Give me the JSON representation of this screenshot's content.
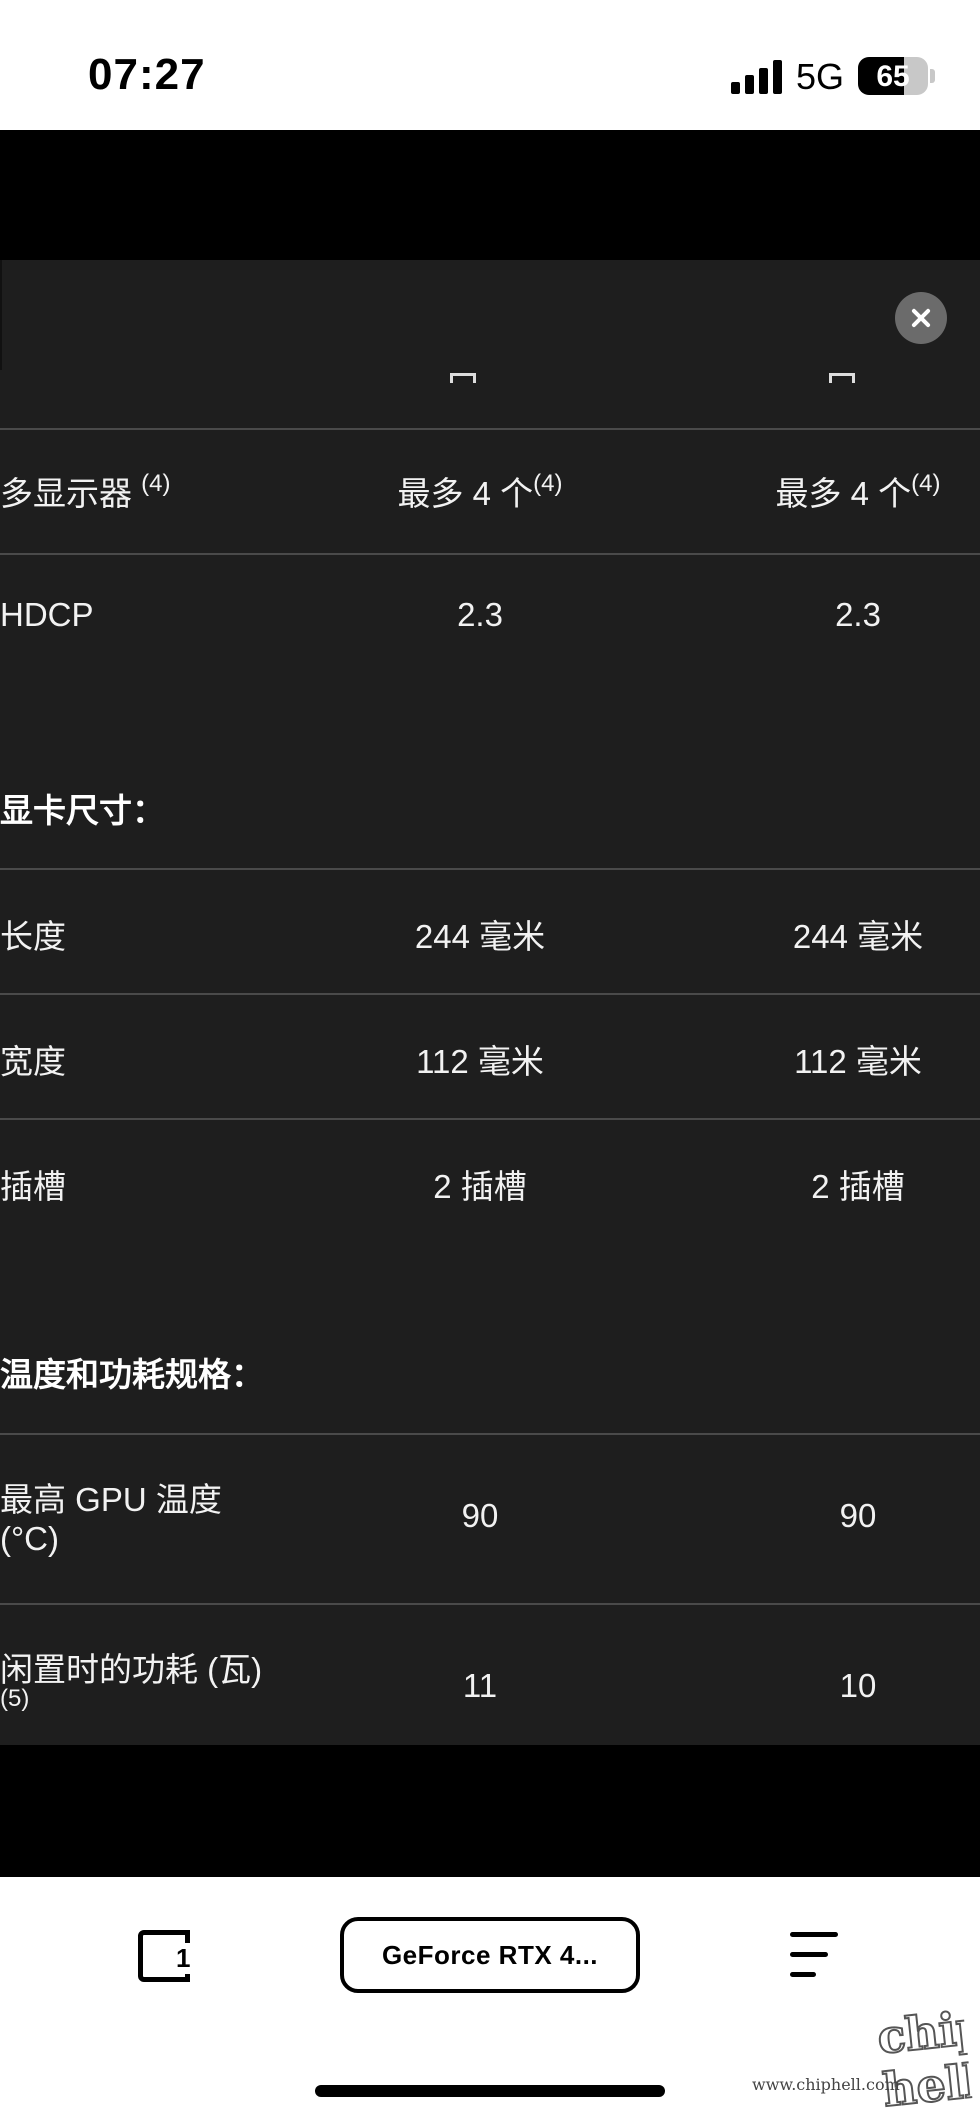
{
  "status_bar": {
    "time": "07:27",
    "network": "5G",
    "battery_percent": 65,
    "battery_label": "65"
  },
  "specs": {
    "rows_top": [
      {
        "label": "多显示器 ",
        "label_sup": "(4)",
        "v1": "最多 4 个",
        "v1_sup": "(4)",
        "v2": "最多 4 个",
        "v2_sup": "(4)"
      },
      {
        "label": "HDCP",
        "v1": "2.3",
        "v2": "2.3"
      }
    ],
    "section_dimensions": "显卡尺寸：",
    "rows_dimensions": [
      {
        "label": "长度",
        "v1": "244 毫米",
        "v2": "244 毫米"
      },
      {
        "label": "宽度",
        "v1": "112 毫米",
        "v2": "112 毫米"
      },
      {
        "label": "插槽",
        "v1": "2 插槽",
        "v2": "2 插槽"
      }
    ],
    "section_thermal": "温度和功耗规格：",
    "rows_thermal": [
      {
        "label_line1": "最高 GPU 温度",
        "label_line2": "(°C)",
        "v1": "90",
        "v2": "90"
      },
      {
        "label_line1": "闲置时的功耗 (瓦)",
        "label_note": "(5)",
        "v1": "11",
        "v2": "10"
      }
    ]
  },
  "bottom_bar": {
    "tab_count": "1",
    "url_label": "GeForce RTX 4..."
  },
  "watermark": {
    "site": "www.chiphell.com",
    "logo": "chip hell"
  },
  "colors": {
    "panel_bg": "#1e1e1e",
    "divider": "#4a4a4a",
    "close_button": "#6b6b6b"
  }
}
